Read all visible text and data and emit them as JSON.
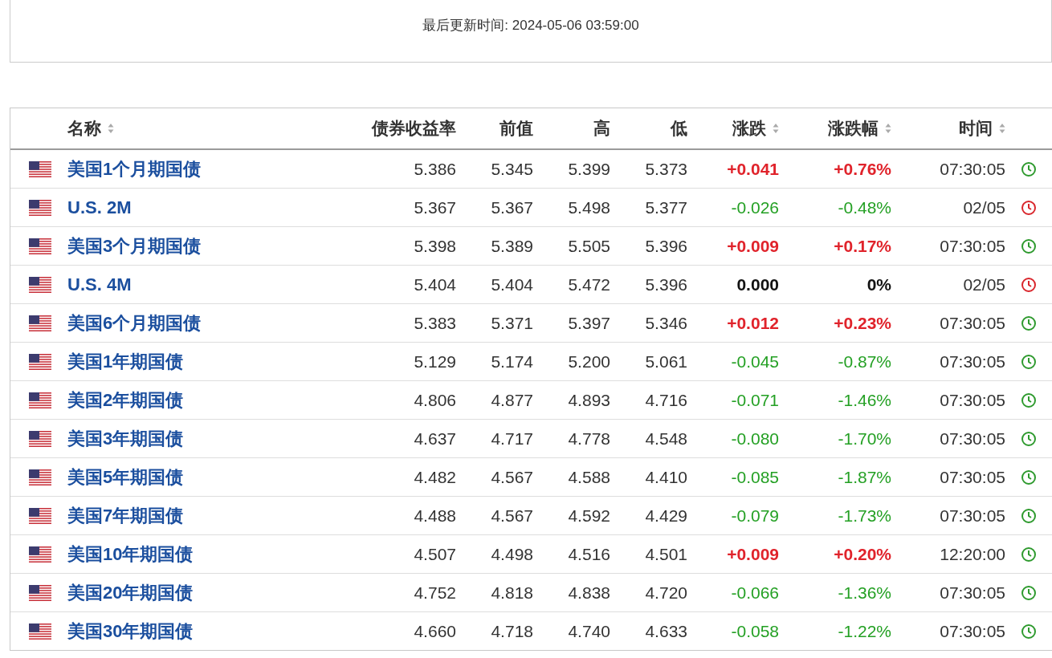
{
  "update_time": "最后更新时间: 2024-05-06 03:59:00",
  "columns": [
    {
      "label": "名称",
      "sortable": true
    },
    {
      "label": "债券收益率",
      "sortable": false
    },
    {
      "label": "前值",
      "sortable": false
    },
    {
      "label": "高",
      "sortable": false
    },
    {
      "label": "低",
      "sortable": false
    },
    {
      "label": "涨跌",
      "sortable": true
    },
    {
      "label": "涨跌幅",
      "sortable": true
    },
    {
      "label": "时间",
      "sortable": true
    }
  ],
  "rows": [
    {
      "name": "美国1个月期国债",
      "yield": "5.386",
      "prev": "5.345",
      "high": "5.399",
      "low": "5.373",
      "change": "+0.041",
      "change_pct": "+0.76%",
      "time": "07:30:05",
      "color": "#e0232b",
      "bold": true,
      "market_open": true
    },
    {
      "name": "U.S. 2M",
      "yield": "5.367",
      "prev": "5.367",
      "high": "5.498",
      "low": "5.377",
      "change": "-0.026",
      "change_pct": "-0.48%",
      "time": "02/05",
      "color": "#24a024",
      "bold": false,
      "market_open": false
    },
    {
      "name": "美国3个月期国债",
      "yield": "5.398",
      "prev": "5.389",
      "high": "5.505",
      "low": "5.396",
      "change": "+0.009",
      "change_pct": "+0.17%",
      "time": "07:30:05",
      "color": "#e0232b",
      "bold": true,
      "market_open": true
    },
    {
      "name": "U.S. 4M",
      "yield": "5.404",
      "prev": "5.404",
      "high": "5.472",
      "low": "5.396",
      "change": "0.000",
      "change_pct": "0%",
      "time": "02/05",
      "color": "#111111",
      "bold": true,
      "market_open": false
    },
    {
      "name": "美国6个月期国债",
      "yield": "5.383",
      "prev": "5.371",
      "high": "5.397",
      "low": "5.346",
      "change": "+0.012",
      "change_pct": "+0.23%",
      "time": "07:30:05",
      "color": "#e0232b",
      "bold": true,
      "market_open": true
    },
    {
      "name": "美国1年期国债",
      "yield": "5.129",
      "prev": "5.174",
      "high": "5.200",
      "low": "5.061",
      "change": "-0.045",
      "change_pct": "-0.87%",
      "time": "07:30:05",
      "color": "#24a024",
      "bold": false,
      "market_open": true
    },
    {
      "name": "美国2年期国债",
      "yield": "4.806",
      "prev": "4.877",
      "high": "4.893",
      "low": "4.716",
      "change": "-0.071",
      "change_pct": "-1.46%",
      "time": "07:30:05",
      "color": "#24a024",
      "bold": false,
      "market_open": true
    },
    {
      "name": "美国3年期国债",
      "yield": "4.637",
      "prev": "4.717",
      "high": "4.778",
      "low": "4.548",
      "change": "-0.080",
      "change_pct": "-1.70%",
      "time": "07:30:05",
      "color": "#24a024",
      "bold": false,
      "market_open": true
    },
    {
      "name": "美国5年期国债",
      "yield": "4.482",
      "prev": "4.567",
      "high": "4.588",
      "low": "4.410",
      "change": "-0.085",
      "change_pct": "-1.87%",
      "time": "07:30:05",
      "color": "#24a024",
      "bold": false,
      "market_open": true
    },
    {
      "name": "美国7年期国债",
      "yield": "4.488",
      "prev": "4.567",
      "high": "4.592",
      "low": "4.429",
      "change": "-0.079",
      "change_pct": "-1.73%",
      "time": "07:30:05",
      "color": "#24a024",
      "bold": false,
      "market_open": true
    },
    {
      "name": "美国10年期国债",
      "yield": "4.507",
      "prev": "4.498",
      "high": "4.516",
      "low": "4.501",
      "change": "+0.009",
      "change_pct": "+0.20%",
      "time": "12:20:00",
      "color": "#e0232b",
      "bold": true,
      "market_open": true
    },
    {
      "name": "美国20年期国债",
      "yield": "4.752",
      "prev": "4.818",
      "high": "4.838",
      "low": "4.720",
      "change": "-0.066",
      "change_pct": "-1.36%",
      "time": "07:30:05",
      "color": "#24a024",
      "bold": false,
      "market_open": true
    },
    {
      "name": "美国30年期国债",
      "yield": "4.660",
      "prev": "4.718",
      "high": "4.740",
      "low": "4.633",
      "change": "-0.058",
      "change_pct": "-1.22%",
      "time": "07:30:05",
      "color": "#24a024",
      "bold": false,
      "market_open": true
    }
  ]
}
